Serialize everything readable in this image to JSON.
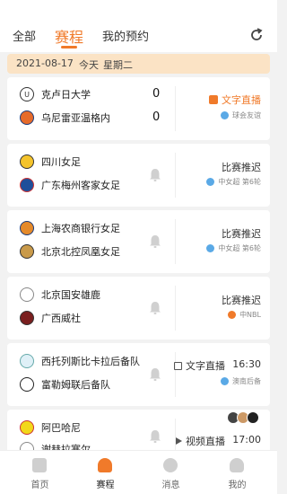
{
  "tabs": {
    "all": "全部",
    "schedule": "赛程",
    "my_bookings": "我的预约"
  },
  "date": {
    "date": "2021-08-17",
    "today": "今天",
    "weekday": "星期二"
  },
  "matches": [
    {
      "home": "克卢日大学",
      "away": "乌尼雷亚温格内",
      "home_score": "0",
      "away_score": "0",
      "status": "文字直播",
      "league": "球会友谊"
    },
    {
      "home": "四川女足",
      "away": "广东梅州客家女足",
      "status": "比赛推迟",
      "league": "中女超 第6轮"
    },
    {
      "home": "上海农商银行女足",
      "away": "北京北控凤凰女足",
      "status": "比赛推迟",
      "league": "中女超 第6轮"
    },
    {
      "home": "北京国安雄鹿",
      "away": "广西威社",
      "status": "比赛推迟",
      "league": "中NBL"
    },
    {
      "home": "西托列斯比卡拉后备队",
      "away": "富勒姆联后备队",
      "status": "文字直播",
      "time": "16:30",
      "league": "澳南后备"
    },
    {
      "home": "阿巴哈尼",
      "away": "谢赫拉塞尔",
      "status": "视频直播",
      "time": "17:00"
    }
  ],
  "nav": {
    "home": "首页",
    "schedule": "赛程",
    "messages": "消息",
    "mine": "我的"
  },
  "colors": {
    "accent": "#f07a2a",
    "date_bar": "#fbe3c5"
  }
}
